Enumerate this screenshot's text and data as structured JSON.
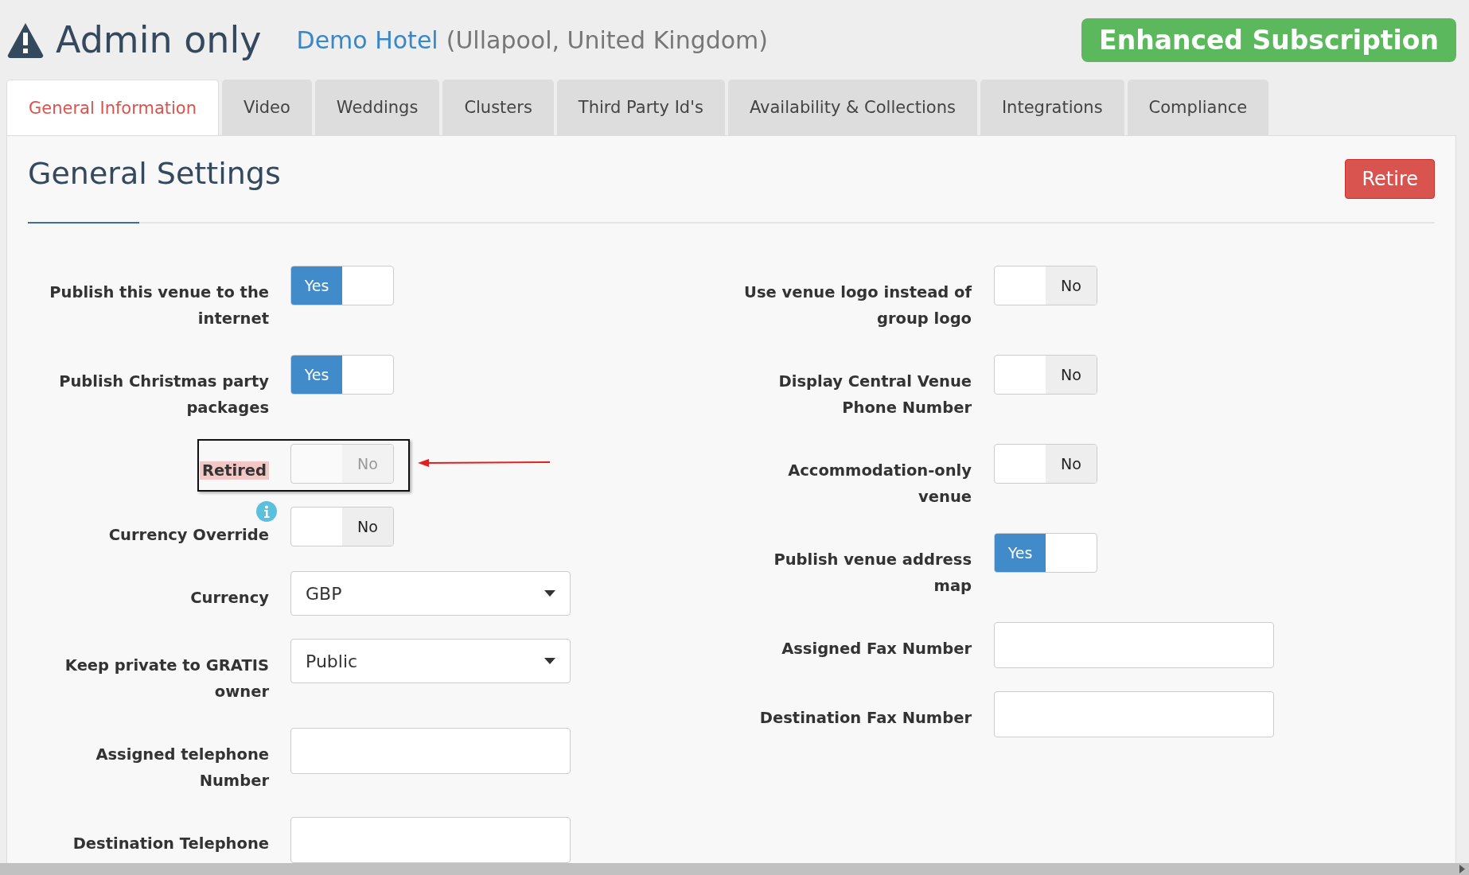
{
  "header": {
    "title": "Admin only",
    "venue_link": "Demo Hotel",
    "venue_location": "(Ullapool, United Kingdom)",
    "subscription_badge": "Enhanced Subscription"
  },
  "tabs": [
    {
      "label": "General Information",
      "selected": true
    },
    {
      "label": "Video",
      "selected": false
    },
    {
      "label": "Weddings",
      "selected": false
    },
    {
      "label": "Clusters",
      "selected": false
    },
    {
      "label": "Third Party Id's",
      "selected": false
    },
    {
      "label": "Availability & Collections",
      "selected": false
    },
    {
      "label": "Integrations",
      "selected": false
    },
    {
      "label": "Compliance",
      "selected": false
    }
  ],
  "section": {
    "title": "General Settings",
    "retire_button": "Retire"
  },
  "left_fields": [
    {
      "kind": "toggle",
      "label": "Publish this venue to the internet",
      "on": true,
      "text": "Yes"
    },
    {
      "kind": "toggle",
      "label": "Publish Christmas party packages",
      "on": true,
      "text": "Yes"
    },
    {
      "kind": "toggle",
      "label": "Retired",
      "on": false,
      "text": "No",
      "disabled": true,
      "highlighted": true,
      "annotated": true
    },
    {
      "kind": "toggle",
      "label": "Currency Override",
      "on": false,
      "text": "No",
      "info": true
    },
    {
      "kind": "select",
      "label": "Currency",
      "value": "GBP"
    },
    {
      "kind": "select",
      "label": "Keep private to GRATIS owner",
      "value": "Public"
    },
    {
      "kind": "text",
      "label": "Assigned telephone Number"
    },
    {
      "kind": "text",
      "label": "Destination Telephone"
    }
  ],
  "right_fields": [
    {
      "kind": "toggle",
      "label": "Use venue logo instead of group logo",
      "on": false,
      "text": "No"
    },
    {
      "kind": "toggle",
      "label": "Display Central Venue Phone Number",
      "on": false,
      "text": "No"
    },
    {
      "kind": "toggle",
      "label": "Accommodation-only venue",
      "on": false,
      "text": "No"
    },
    {
      "kind": "toggle",
      "label": "Publish venue address map",
      "on": true,
      "text": "Yes"
    },
    {
      "kind": "text",
      "label": "Assigned Fax Number"
    },
    {
      "kind": "text",
      "label": "Destination Fax Number"
    }
  ]
}
